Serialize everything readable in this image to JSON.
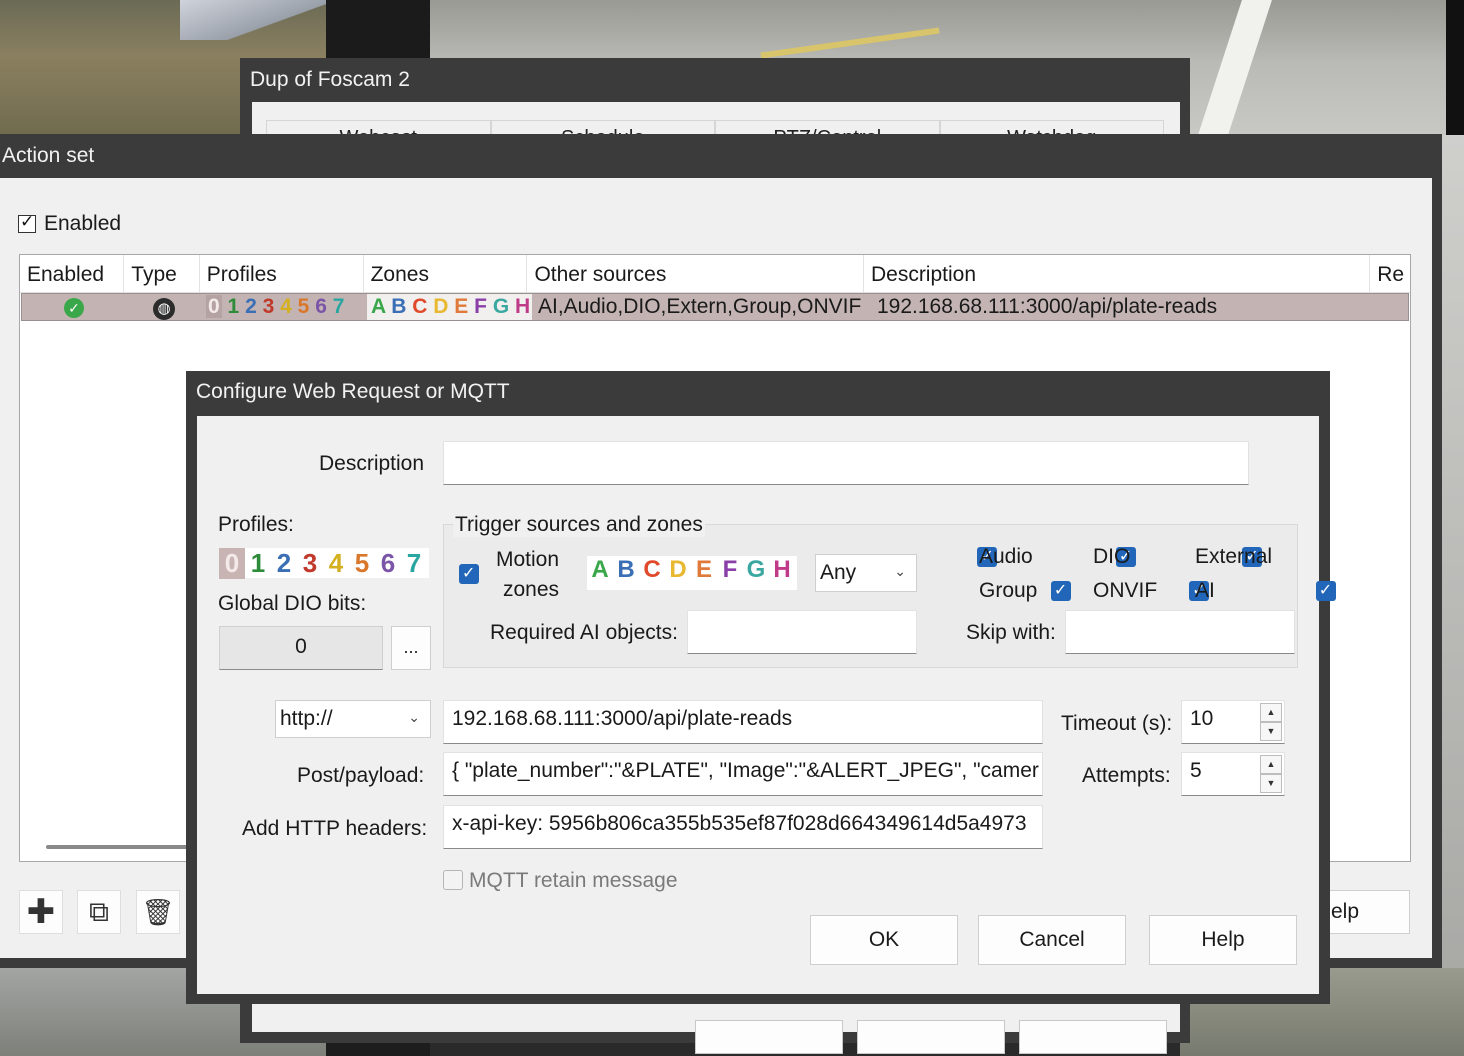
{
  "foscam_window": {
    "title": "Dup of Foscam 2",
    "tabs": [
      "Webcast",
      "Schedule",
      "PTZ/Control",
      "Watchdog"
    ]
  },
  "action_set": {
    "title": "Action set",
    "enabled_label": "Enabled",
    "columns": [
      "Enabled",
      "Type",
      "Profiles",
      "Zones",
      "Other sources",
      "Description",
      "Re"
    ],
    "row": {
      "profiles": [
        "0",
        "1",
        "2",
        "3",
        "4",
        "5",
        "6",
        "7"
      ],
      "zones": [
        "A",
        "B",
        "C",
        "D",
        "E",
        "F",
        "G",
        "H"
      ],
      "other_sources": "AI,Audio,DIO,Extern,Group,ONVIF",
      "description": "192.168.68.111:3000/api/plate-reads"
    },
    "help_partial": "elp"
  },
  "config_dialog": {
    "title": "Configure Web Request or MQTT",
    "description_label": "Description",
    "description_value": "",
    "profiles_label": "Profiles:",
    "profile_digits": [
      "0",
      "1",
      "2",
      "3",
      "4",
      "5",
      "6",
      "7"
    ],
    "profile_colors": [
      "#b5a3a3",
      "#2e8b3a",
      "#3a6fb5",
      "#c0392b",
      "#d4b020",
      "#d9772b",
      "#7a55a8",
      "#2aa6a0"
    ],
    "global_dio_label": "Global DIO bits:",
    "global_dio_value": "0",
    "ellipsis": "...",
    "trigger_group_label": "Trigger sources and zones",
    "motion_zones_label_1": "Motion",
    "motion_zones_label_2": "zones",
    "zone_letters": [
      "A",
      "B",
      "C",
      "D",
      "E",
      "F",
      "G",
      "H"
    ],
    "zone_colors": [
      "#3aa84a",
      "#3a6fb5",
      "#e04a2a",
      "#e8b830",
      "#e07a3a",
      "#8a3fa8",
      "#3aa8a0",
      "#c03a8a"
    ],
    "zones_combo_value": "Any",
    "sources": [
      "Audio",
      "DIO",
      "External",
      "Group",
      "ONVIF",
      "AI"
    ],
    "required_ai_label": "Required AI objects:",
    "required_ai_value": "",
    "skip_with_label": "Skip with:",
    "skip_with_value": "",
    "protocol_value": "http://",
    "url_value": "192.168.68.111:3000/api/plate-reads",
    "post_payload_label": "Post/payload:",
    "post_payload_value": "{ \"plate_number\":\"&PLATE\", \"Image\":\"&ALERT_JPEG\", \"camer",
    "headers_label": "Add HTTP headers:",
    "headers_value": "x-api-key: 5956b806ca355b535ef87f028d664349614d5a4973",
    "timeout_label": "Timeout (s):",
    "timeout_value": "10",
    "attempts_label": "Attempts:",
    "attempts_value": "5",
    "mqtt_retain_label": "MQTT retain message",
    "ok_label": "OK",
    "cancel_label": "Cancel",
    "help_label": "Help"
  }
}
